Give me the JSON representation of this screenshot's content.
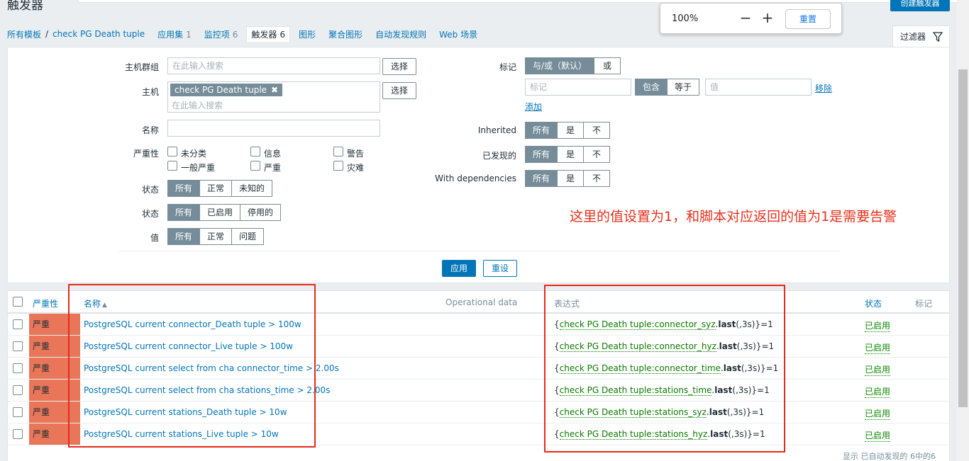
{
  "page": {
    "title": "触发器",
    "create_button": "创建触发器"
  },
  "zoom": {
    "value": "100%",
    "minus": "−",
    "plus": "+",
    "reset": "重置"
  },
  "nav": {
    "all_templates": "所有模板",
    "separator": "/",
    "template": "check PG Death tuple",
    "tabs": [
      {
        "label": "应用集",
        "count": "1"
      },
      {
        "label": "监控项",
        "count": "6"
      },
      {
        "label": "触发器",
        "count": "6"
      },
      {
        "label": "图形",
        "count": ""
      },
      {
        "label": "聚合图形",
        "count": ""
      },
      {
        "label": "自动发现规则",
        "count": ""
      },
      {
        "label": "Web 场景",
        "count": ""
      }
    ]
  },
  "filter": {
    "tab_label": "过滤器",
    "icon": "funnel-icon",
    "host_group": {
      "label": "主机群组",
      "placeholder": "在此输入搜索",
      "select": "选择"
    },
    "host": {
      "label": "主机",
      "chip": "check PG Death tuple",
      "chip_remove": "✖",
      "placeholder": "在此输入搜索",
      "select": "选择"
    },
    "name": {
      "label": "名称",
      "value": ""
    },
    "severity": {
      "label": "严重性",
      "options": [
        "未分类",
        "信息",
        "警告",
        "一般严重",
        "严重",
        "灾难"
      ]
    },
    "state": {
      "label": "状态",
      "options": [
        "所有",
        "正常",
        "未知的"
      ],
      "selected": "所有"
    },
    "status": {
      "label": "状态",
      "options": [
        "所有",
        "已启用",
        "停用的"
      ],
      "selected": "所有"
    },
    "value": {
      "label": "值",
      "options": [
        "所有",
        "正常",
        "问题"
      ],
      "selected": "所有"
    },
    "tags": {
      "label": "标记",
      "mode_options": [
        "与/或（默认）",
        "或"
      ],
      "mode_selected": "与/或（默认）",
      "tag_placeholder": "标记",
      "op_options": [
        "包含",
        "等于"
      ],
      "op_selected": "包含",
      "value_placeholder": "值",
      "remove": "移除",
      "add": "添加"
    },
    "inherited": {
      "label": "Inherited",
      "options": [
        "所有",
        "是",
        "不"
      ],
      "selected": "所有"
    },
    "discovered": {
      "label": "已发现的",
      "options": [
        "所有",
        "是",
        "不"
      ],
      "selected": "所有"
    },
    "with_dependencies": {
      "label": "With dependencies",
      "options": [
        "所有",
        "是",
        "不"
      ],
      "selected": "所有"
    },
    "apply": "应用",
    "reset": "重设"
  },
  "annotation": "这里的值设置为1，和脚本对应返回的值为1是需要告警",
  "table": {
    "headers": {
      "severity": "严重性",
      "name": "名称",
      "sort_arrow": "▲",
      "operational": "Operational data",
      "expression": "表达式",
      "status": "状态",
      "tags": "标记"
    },
    "rows": [
      {
        "severity": "严重",
        "name": "PostgreSQL current connector_Death tuple > 100w",
        "expr_open": "{",
        "host_key": "check PG Death tuple:connector_syz",
        "dot": ".",
        "fn": "last",
        "expr_tail": "(,3s)}=1",
        "status": "已启用"
      },
      {
        "severity": "严重",
        "name": "PostgreSQL current connector_Live tuple > 100w",
        "expr_open": "{",
        "host_key": "check PG Death tuple:connector_hyz",
        "dot": ".",
        "fn": "last",
        "expr_tail": "(,3s)}=1",
        "status": "已启用"
      },
      {
        "severity": "严重",
        "name": "PostgreSQL current select from cha connector_time > 2.00s",
        "expr_open": "{",
        "host_key": "check PG Death tuple:connector_time",
        "dot": ".",
        "fn": "last",
        "expr_tail": "(,3s)}=1",
        "status": "已启用"
      },
      {
        "severity": "严重",
        "name": "PostgreSQL current select from cha stations_time > 2.00s",
        "expr_open": "{",
        "host_key": "check PG Death tuple:stations_time",
        "dot": ".",
        "fn": "last",
        "expr_tail": "(,3s)}=1",
        "status": "已启用"
      },
      {
        "severity": "严重",
        "name": "PostgreSQL current stations_Death tuple > 10w",
        "expr_open": "{",
        "host_key": "check PG Death tuple:stations_syz",
        "dot": ".",
        "fn": "last",
        "expr_tail": "(,3s)}=1",
        "status": "已启用"
      },
      {
        "severity": "严重",
        "name": "PostgreSQL current stations_Live tuple > 10w",
        "expr_open": "{",
        "host_key": "check PG Death tuple:stations_hyz",
        "dot": ".",
        "fn": "last",
        "expr_tail": "(,3s)}=1",
        "status": "已启用"
      }
    ],
    "footer": "显示 已自动发现的 6中的6"
  },
  "colors": {
    "accent": "#0275b8",
    "severity_high": "#e97659",
    "annotation": "#e7301c",
    "enabled": "#0b8a00"
  }
}
